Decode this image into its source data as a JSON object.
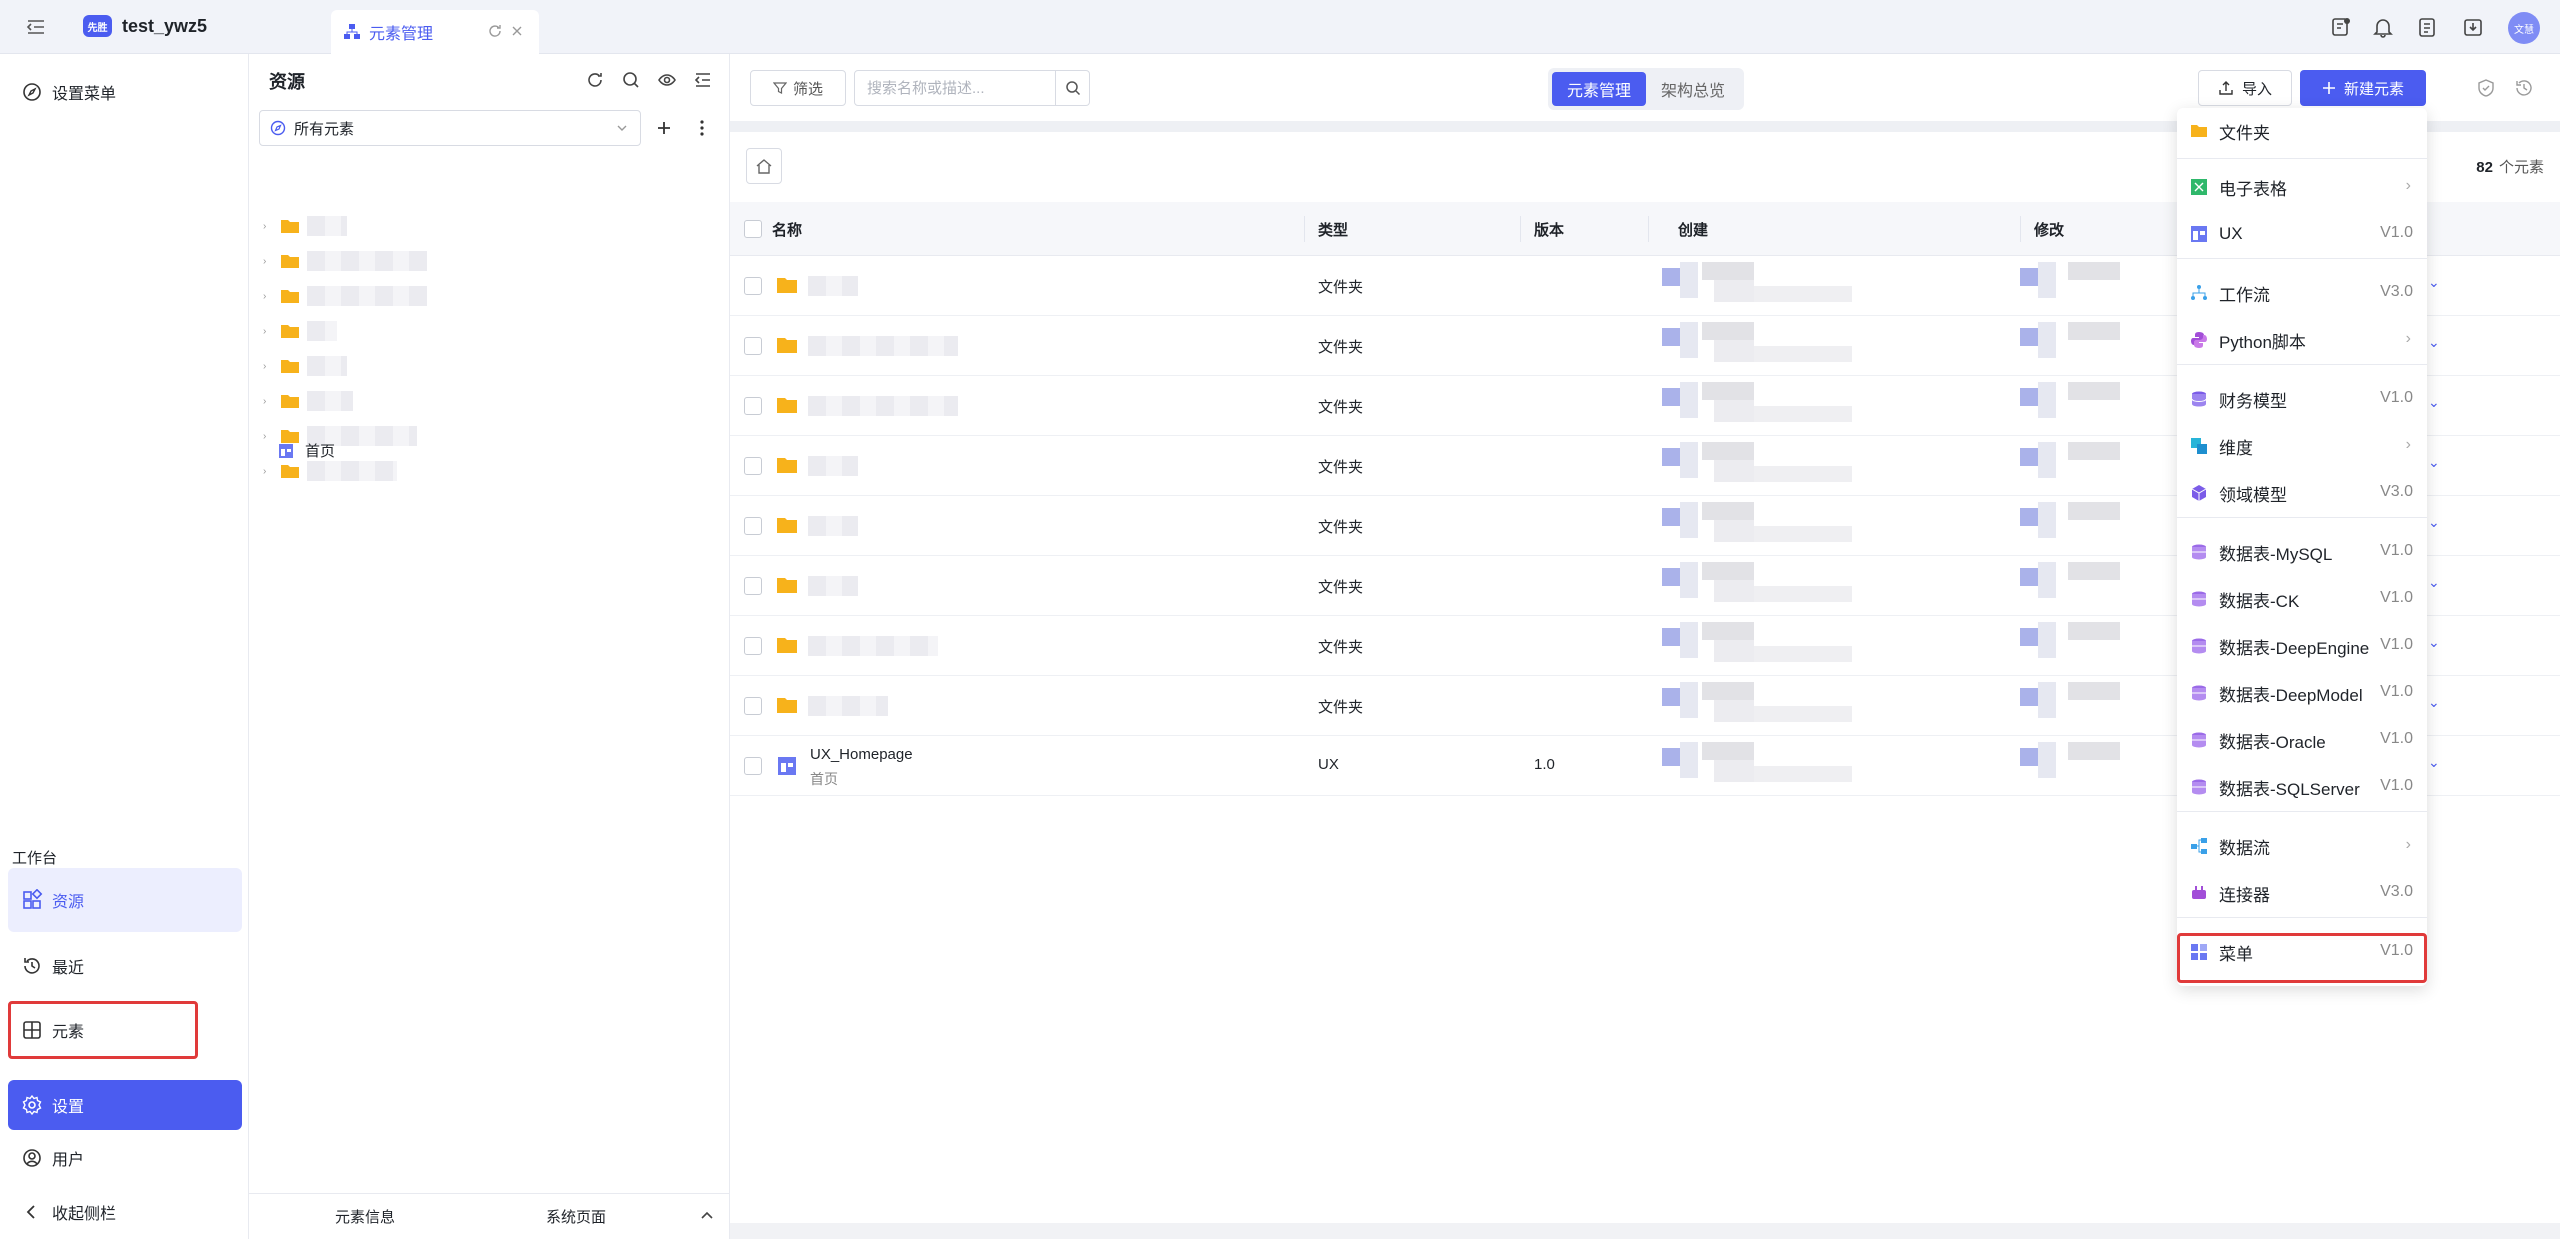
{
  "topbar": {
    "logo_text": "先胜",
    "project_name": "test_ywz5",
    "tab_label": "元素管理",
    "avatar_text": "文慧"
  },
  "leftnav": {
    "settings_menu": "设置菜单",
    "workbench_label": "工作台",
    "resources": "资源",
    "recent": "最近",
    "elements": "元素",
    "settings": "设置",
    "users": "用户",
    "collapse": "收起侧栏"
  },
  "resources_panel": {
    "title": "资源",
    "filter_value": "所有元素",
    "home_item": "首页",
    "footer_info": "元素信息",
    "footer_pages": "系统页面"
  },
  "toolbar": {
    "filter": "筛选",
    "search_placeholder": "搜索名称或描述...",
    "seg_manage": "元素管理",
    "seg_overview": "架构总览",
    "import": "导入",
    "new_element": "新建元素"
  },
  "list": {
    "count": "82",
    "count_unit": "个元素",
    "headers": {
      "name": "名称",
      "type": "类型",
      "version": "版本",
      "created": "创建",
      "modified": "修改"
    },
    "rows": [
      {
        "type": "文件夹",
        "version": ""
      },
      {
        "type": "文件夹",
        "version": ""
      },
      {
        "type": "文件夹",
        "version": ""
      },
      {
        "type": "文件夹",
        "version": ""
      },
      {
        "type": "文件夹",
        "version": ""
      },
      {
        "type": "文件夹",
        "version": ""
      },
      {
        "type": "文件夹",
        "version": ""
      },
      {
        "type": "文件夹",
        "version": ""
      },
      {
        "name": "UX_Homepage",
        "subtitle": "首页",
        "type": "UX",
        "version": "1.0"
      }
    ]
  },
  "dropdown": {
    "items": [
      {
        "label": "文件夹",
        "version": ""
      },
      {
        "label": "电子表格",
        "version": ""
      },
      {
        "label": "UX",
        "version": "V1.0"
      },
      {
        "label": "工作流",
        "version": "V3.0"
      },
      {
        "label": "Python脚本",
        "version": ""
      },
      {
        "label": "财务模型",
        "version": "V1.0"
      },
      {
        "label": "维度",
        "version": ""
      },
      {
        "label": "领域模型",
        "version": "V3.0"
      },
      {
        "label": "数据表-MySQL",
        "version": "V1.0"
      },
      {
        "label": "数据表-CK",
        "version": "V1.0"
      },
      {
        "label": "数据表-DeepEngine",
        "version": "V1.0"
      },
      {
        "label": "数据表-DeepModel",
        "version": "V1.0"
      },
      {
        "label": "数据表-Oracle",
        "version": "V1.0"
      },
      {
        "label": "数据表-SQLServer",
        "version": "V1.0"
      },
      {
        "label": "数据流",
        "version": ""
      },
      {
        "label": "连接器",
        "version": "V3.0"
      },
      {
        "label": "菜单",
        "version": "V1.0"
      }
    ]
  },
  "colors": {
    "accent": "#4b5cf0",
    "highlight_border": "#e03a3a",
    "folder": "#f7b21b"
  }
}
